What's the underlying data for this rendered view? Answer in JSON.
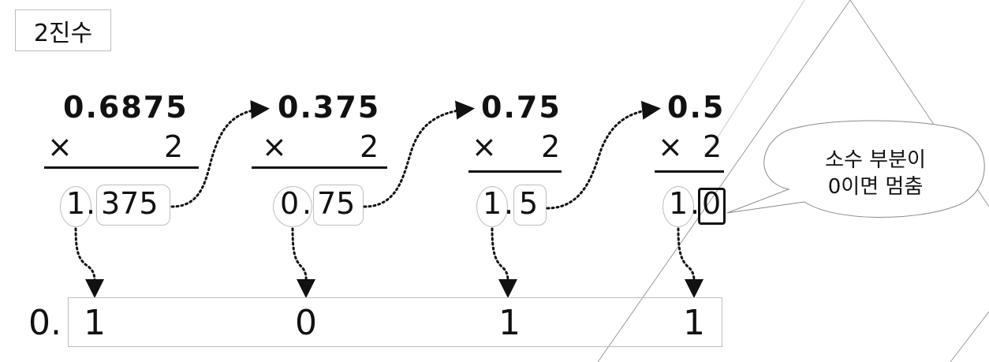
{
  "title": "2진수",
  "steps": [
    {
      "value": "0.6875",
      "times": "×",
      "multiplier": "2",
      "int_part": "1",
      "dot": ".",
      "frac_part": "375"
    },
    {
      "value": "0.375",
      "times": "×",
      "multiplier": "2",
      "int_part": "0",
      "dot": ".",
      "frac_part": "75"
    },
    {
      "value": "0.75",
      "times": "×",
      "multiplier": "2",
      "int_part": "1",
      "dot": ".",
      "frac_part": "5"
    },
    {
      "value": "0.5",
      "times": "×",
      "multiplier": "2",
      "int_part": "1",
      "dot": ".",
      "frac_part": "0"
    }
  ],
  "answer": {
    "prefix": "0.",
    "digits": [
      "1",
      "0",
      "1",
      "1"
    ]
  },
  "callout": {
    "line1": "소수 부분이",
    "line2": "0이면 멈춤"
  },
  "colors": {
    "text": "#111111",
    "box_border": "#bdbdbd",
    "background": "#ffffff"
  }
}
